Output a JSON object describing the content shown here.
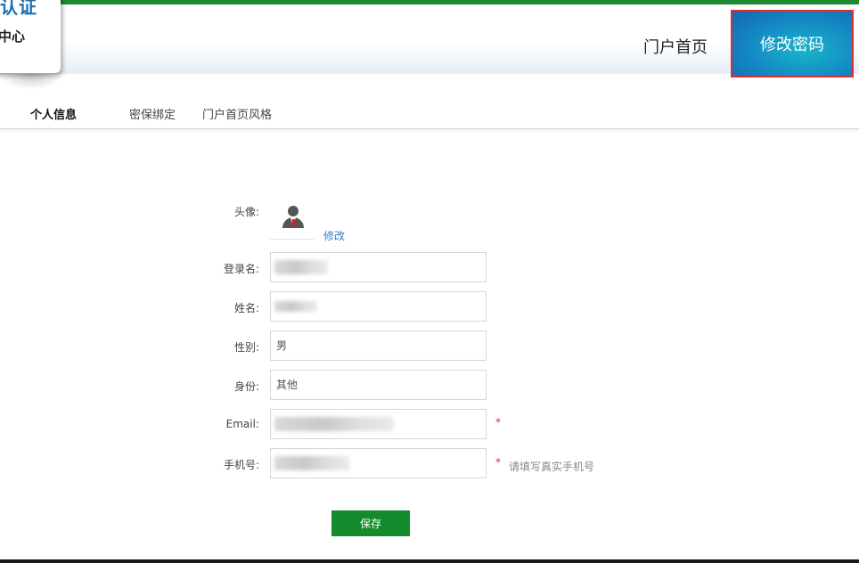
{
  "logo": {
    "line1": "认证",
    "line2": "中心"
  },
  "header": {
    "nav_home": "门户首页",
    "nav_change_password": "修改密码"
  },
  "tabs": [
    {
      "label": "个人信息",
      "active": true
    },
    {
      "label": "密保绑定",
      "active": false
    },
    {
      "label": "门户首页风格",
      "active": false
    }
  ],
  "form": {
    "avatar_label": "头像:",
    "avatar_edit": "修改",
    "login_label": "登录名:",
    "name_label": "姓名:",
    "gender_label": "性别:",
    "gender_value": "男",
    "identity_label": "身份:",
    "identity_value": "其他",
    "email_label": "Email:",
    "email_required": "*",
    "phone_label": "手机号:",
    "phone_required": "*",
    "phone_hint": "请填写真实手机号",
    "save_label": "保存"
  },
  "colors": {
    "brand_green": "#1d8a32",
    "accent_blue": "#1488c4",
    "required_red": "#e03030",
    "link_blue": "#2f7fd1"
  }
}
